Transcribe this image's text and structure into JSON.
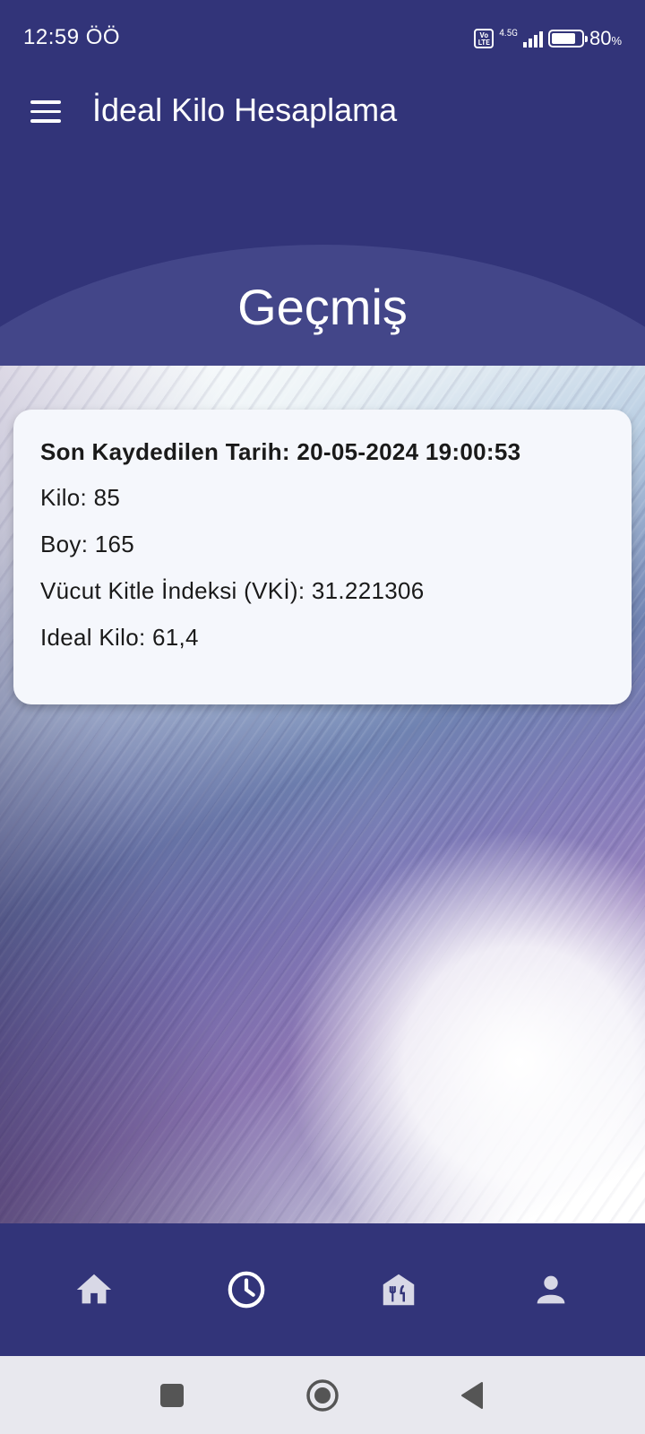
{
  "status_bar": {
    "time": "12:59 ÖÖ",
    "volte": "Vo LTE",
    "network": "4.5G",
    "battery_percent": "80",
    "battery_suffix": "%"
  },
  "app_bar": {
    "title": "İdeal Kilo Hesaplama",
    "menu_icon": "hamburger-menu-icon"
  },
  "header": {
    "title": "Geçmiş"
  },
  "record": {
    "date_line": "Son Kaydedilen Tarih: 20-05-2024 19:00:53",
    "weight_line": "Kilo: 85",
    "height_line": "Boy: 165",
    "bmi_line": "Vücut Kitle İndeksi (VKİ): 31.221306",
    "ideal_line": "Ideal Kilo: 61,4"
  },
  "bottom_nav": {
    "items": [
      {
        "icon": "home-icon"
      },
      {
        "icon": "history-clock-icon",
        "selected": true
      },
      {
        "icon": "restaurant-icon"
      },
      {
        "icon": "person-icon"
      }
    ]
  },
  "colors": {
    "primary": "#323479",
    "arc": "#434689",
    "card_bg": "#f5f7fc",
    "nav_icon_inactive": "#d8d8e6",
    "nav_icon_active": "#ffffff"
  }
}
